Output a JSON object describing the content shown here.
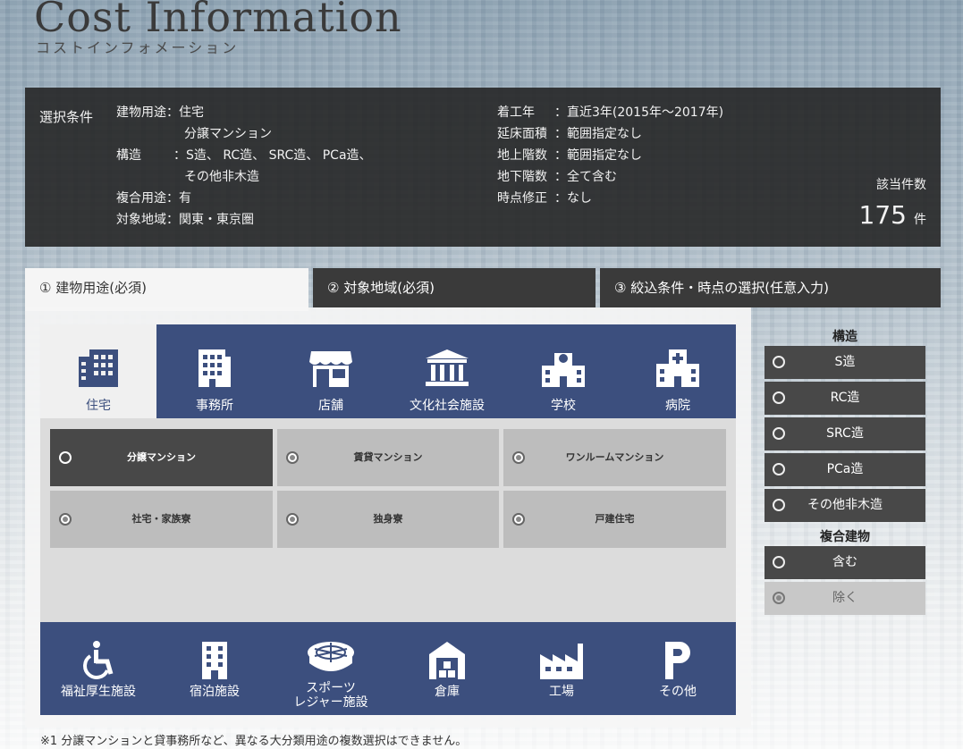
{
  "header": {
    "title": "Cost Information",
    "subtitle": "コストインフォメーション"
  },
  "summary": {
    "label": "選択条件",
    "left": [
      {
        "key": "建物用途：",
        "value": "住宅"
      },
      {
        "key": "",
        "value": "分譲マンション"
      },
      {
        "key": "構造",
        "value": "：S造、 RC造、 SRC造、 PCa造、"
      },
      {
        "key": "",
        "value": "その他非木造"
      },
      {
        "key": "複合用途：",
        "value": "有"
      },
      {
        "key": "対象地域：",
        "value": "関東・東京圏"
      }
    ],
    "right": [
      {
        "key": "着工年",
        "value": "：直近3年(2015年～2017年)"
      },
      {
        "key": "延床面積",
        "value": "：範囲指定なし"
      },
      {
        "key": "地上階数",
        "value": "：範囲指定なし"
      },
      {
        "key": "地下階数",
        "value": "：全て含む"
      },
      {
        "key": "時点修正",
        "value": "：なし"
      }
    ],
    "count_label": "該当件数",
    "count_value": "175",
    "count_unit": "件"
  },
  "steps": [
    {
      "label": "① 建物用途(必須)"
    },
    {
      "label": "② 対象地域(必須)"
    },
    {
      "label": "③ 絞込条件・時点の選択(任意入力)"
    }
  ],
  "categories_top": [
    {
      "label": "住宅",
      "icon": "building-icon"
    },
    {
      "label": "事務所",
      "icon": "office-icon"
    },
    {
      "label": "店舗",
      "icon": "store-icon"
    },
    {
      "label": "文化社会施設",
      "icon": "museum-icon"
    },
    {
      "label": "学校",
      "icon": "school-icon"
    },
    {
      "label": "病院",
      "icon": "hospital-icon"
    }
  ],
  "sub_options": [
    {
      "label": "分譲マンション"
    },
    {
      "label": "賃貸マンション"
    },
    {
      "label": "ワンルームマンション"
    },
    {
      "label": "社宅・家族寮"
    },
    {
      "label": "独身寮"
    },
    {
      "label": "戸建住宅"
    }
  ],
  "categories_bottom": [
    {
      "label": "福祉厚生施設",
      "icon": "wheelchair-icon"
    },
    {
      "label": "宿泊施設",
      "icon": "hotel-icon"
    },
    {
      "label1": "スポーツ",
      "label2": "レジャー施設",
      "icon": "stadium-icon"
    },
    {
      "label": "倉庫",
      "icon": "warehouse-icon"
    },
    {
      "label": "工場",
      "icon": "factory-icon"
    },
    {
      "label": "その他",
      "icon": "parking-icon"
    }
  ],
  "side": {
    "structure_header": "構造",
    "structure": [
      "S造",
      "RC造",
      "SRC造",
      "PCa造",
      "その他非木造"
    ],
    "composite_header": "複合建物",
    "composite": [
      "含む",
      "除く"
    ]
  },
  "note": "※1 分譲マンションと貸事務所など、異なる大分類用途の複数選択はできません。"
}
